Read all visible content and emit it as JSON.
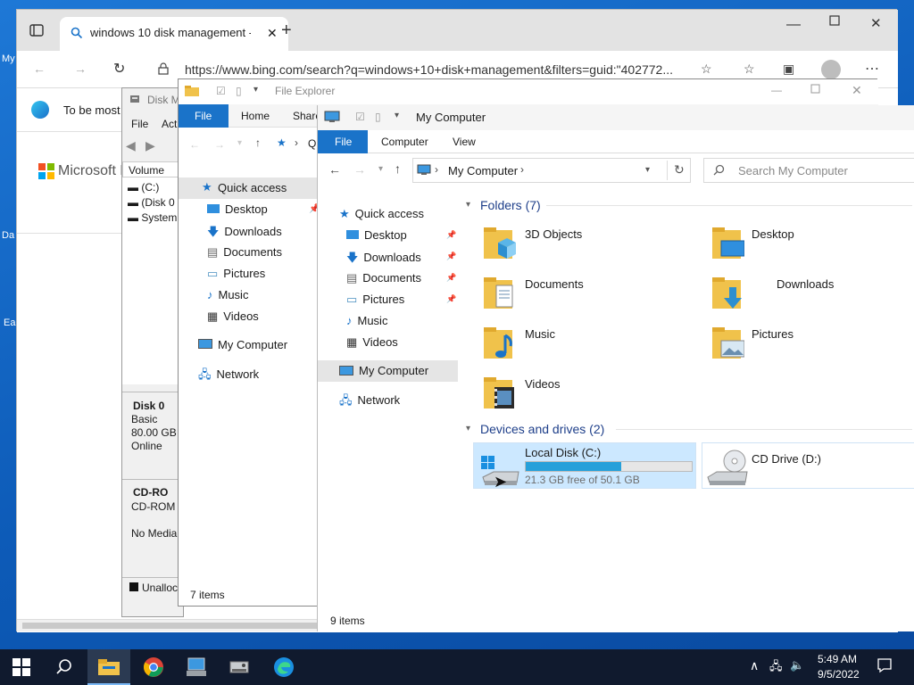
{
  "desktop": {
    "labels": [
      "My",
      "Da",
      "Ea"
    ]
  },
  "edge": {
    "tab_title": "windows 10 disk management -",
    "url": "https://www.bing.com/search?q=windows+10+disk+management&filters=guid:\"402772...",
    "banner_text": "To be most",
    "logo_text": "Microsoft B"
  },
  "disk_mgmt": {
    "title": "Disk M",
    "menu": [
      "File",
      "Act"
    ],
    "column": "Volume",
    "volumes": [
      "(C:)",
      "(Disk 0",
      "System"
    ],
    "disk0": {
      "name": "Disk 0",
      "type": "Basic",
      "size": "80.00 GB",
      "status": "Online"
    },
    "cdrom": {
      "name": "CD-RO",
      "type": "CD-ROM",
      "media": "No Media"
    },
    "legend": "Unalloc"
  },
  "explorer_back": {
    "title": "File Explorer",
    "tabs": [
      "File",
      "Home",
      "Share"
    ],
    "breadcrumb": "Q",
    "nav": {
      "quick_access": "Quick access",
      "items": [
        "Desktop",
        "Downloads",
        "Documents",
        "Pictures",
        "Music",
        "Videos"
      ],
      "computer": "My Computer",
      "network": "Network"
    },
    "status": "7 items"
  },
  "explorer_front": {
    "title": "My Computer",
    "tabs": [
      "File",
      "Computer",
      "View"
    ],
    "address": "My Computer",
    "search_placeholder": "Search My Computer",
    "nav": {
      "quick_access": "Quick access",
      "items": [
        "Desktop",
        "Downloads",
        "Documents",
        "Pictures",
        "Music",
        "Videos"
      ],
      "computer": "My Computer",
      "network": "Network"
    },
    "folders_header": "Folders (7)",
    "folders": [
      "3D Objects",
      "Desktop",
      "Documents",
      "Downloads",
      "Music",
      "Pictures",
      "Videos"
    ],
    "devices_header": "Devices and drives (2)",
    "drives": [
      {
        "name": "Local Disk (C:)",
        "detail": "21.3 GB free of 50.1 GB",
        "used_fraction": 0.575
      },
      {
        "name": "CD Drive (D:)"
      }
    ],
    "status": "9 items"
  },
  "taskbar": {
    "time": "5:49 AM",
    "date": "9/5/2022"
  },
  "colors": {
    "accent": "#1a73c9",
    "drive_bar": "#26a0da",
    "selection": "#cce8ff",
    "folder": "#f0c24b"
  }
}
